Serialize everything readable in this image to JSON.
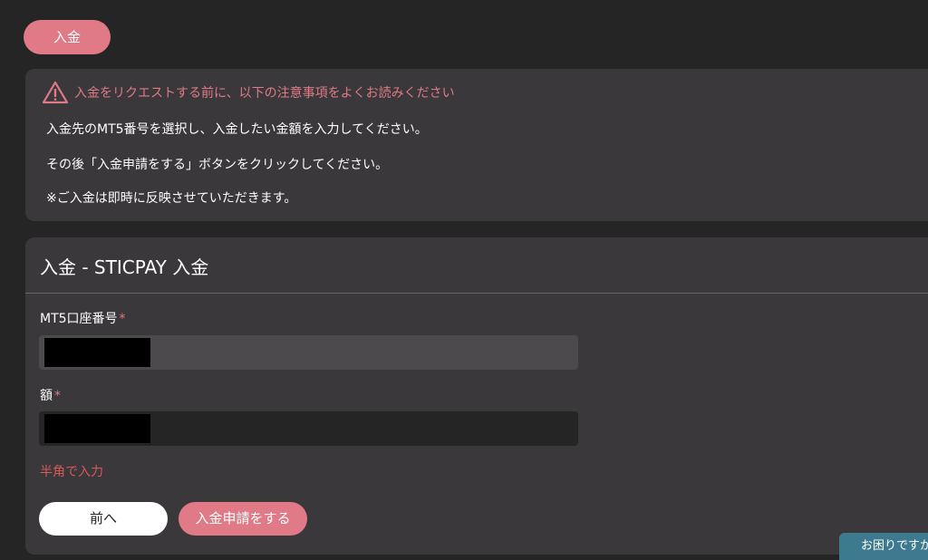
{
  "top_tab": {
    "label": "入金"
  },
  "notice": {
    "title": "入金をリクエストする前に、以下の注意事項をよくお読みください",
    "lines": [
      "入金先のMT5番号を選択し、入金したい金額を入力してください。",
      "その後「入金申請をする」ボタンをクリックしてください。",
      "※ご入金は即時に反映させていただきます。"
    ]
  },
  "form": {
    "title": "入金 - STICPAY 入金",
    "account_label": "MT5口座番号",
    "amount_label": "額",
    "required_mark": "*",
    "hint": "半角で入力",
    "back_label": "前へ",
    "submit_label": "入金申請をする"
  },
  "help": {
    "label": "お困りですか"
  },
  "colors": {
    "accent": "#df7a86",
    "hint": "#d65a5a",
    "help": "#3d7a90"
  }
}
